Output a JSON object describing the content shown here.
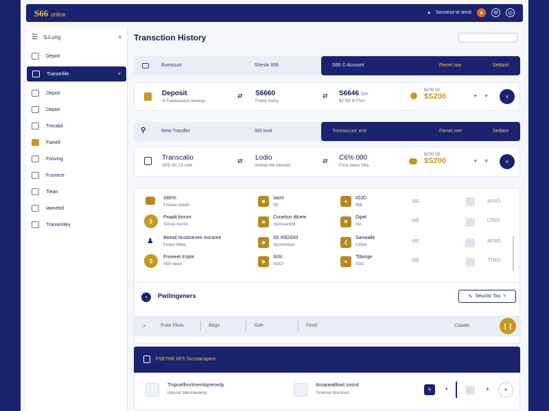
{
  "app": {
    "logo": "S66",
    "logo_sub": "online"
  },
  "topbar": {
    "user_text": "Seceese te Ienst"
  },
  "sidebar": {
    "header": "S̶̶ Lung",
    "items": [
      {
        "label": "Depoit"
      },
      {
        "label": "Transeñile",
        "active": true
      },
      {
        "label": "Depoit"
      },
      {
        "label": "Depoit"
      },
      {
        "label": "Trecabil"
      },
      {
        "label": "Fianell"
      },
      {
        "label": "Fnoving"
      },
      {
        "label": "Fusnece"
      },
      {
        "label": "Tiean"
      },
      {
        "label": "Iawsebd"
      },
      {
        "label": "Transeriiley"
      }
    ]
  },
  "main": {
    "title": "Transction History",
    "search": {
      "placeholder": ""
    },
    "band1": {
      "left": "Boeasunt",
      "mid": "Shesie 656",
      "dark_left": "S66 © Account",
      "dark_mid": "Fienel oae",
      "dark_right": "Setliant"
    },
    "card1": {
      "title": "Deposit",
      "sub": "I4 Faeaeuuaue teieeiay",
      "c2_big": "S6660",
      "c2_sub": "Fnoee loetsy",
      "c3_big": "S6646",
      "c3_extra": "SIm",
      "c3_sub": "$3 I00 I0 Fhre",
      "amt_top": "$C00 IIS",
      "amt": "$S200",
      "plus": "+",
      "plus2": "+"
    },
    "band2": {
      "left": "Mew Tracdler",
      "mid": "SI9 Iouit",
      "dark_left": "Tncesocuor ene",
      "dark_mid": "Fienet oee",
      "dark_right": "Setliant"
    },
    "card2": {
      "title": "Transcalio",
      "sub": "I00D I0L 1S Inite",
      "c2_big": "Lodio",
      "c2_sub": "Ilniteal mie beeeaei",
      "c3_big": "C6%.000",
      "c3_sub": "Fnoe taeee I0lia",
      "amt_top": "$C00 IIS",
      "amt": "$S200",
      "plus": "+",
      "chev": "˅"
    },
    "list": [
      {
        "label": "S66%",
        "sub": "Fimaee eeeeh",
        "t2": "Iaonl",
        "s2": "SII",
        "t3": "IOJD",
        "s3": "I9IE",
        "t4": "SIE",
        "t5": "AFRO"
      },
      {
        "label": "Feaatt bionnt",
        "sub": "Temse ionnot",
        "t2": "Cooelion dlcete",
        "s2": "Spnneanlitiit",
        "t3": "Dipel",
        "s3": "IIIA",
        "t4": "SIE",
        "t5": "LTRO"
      },
      {
        "label": "Beeatl Itnsiiinenee eocaree",
        "sub": "Fintee tiiillee",
        "t2": "S0 IIIIDIOIII",
        "s2": "Spnnlloiteer",
        "t3": "Sanwalle",
        "s3": "CIINIe",
        "t4": "SIE",
        "t5": "AFRO"
      },
      {
        "label": "Fnseeet Irnpte",
        "sub": "I000 oeee",
        "t2": "SISI",
        "s2": "SOOI",
        "t3": "Tiltesqe",
        "s3": "IOIO",
        "t4": "SIE",
        "t5": "TTRO"
      }
    ],
    "section": {
      "title": "Pwilingeners",
      "select_label": "Seuctsr Tou",
      "filters": [
        "Fnite Fkws",
        "Bago",
        "Sale",
        "Fired"
      ],
      "right": "Caaats"
    },
    "bottom": {
      "bar_title": "FSETHE IIFS Tocceacapem",
      "item1": "Tmpuelfnnrtroembprenedy",
      "item1_sub": "Iopesar tiaennaeeeay",
      "item2": "Itcoaoeallliwd sosnd",
      "item2_sub": "Tonenee bnesicao",
      "plus": "+"
    }
  }
}
